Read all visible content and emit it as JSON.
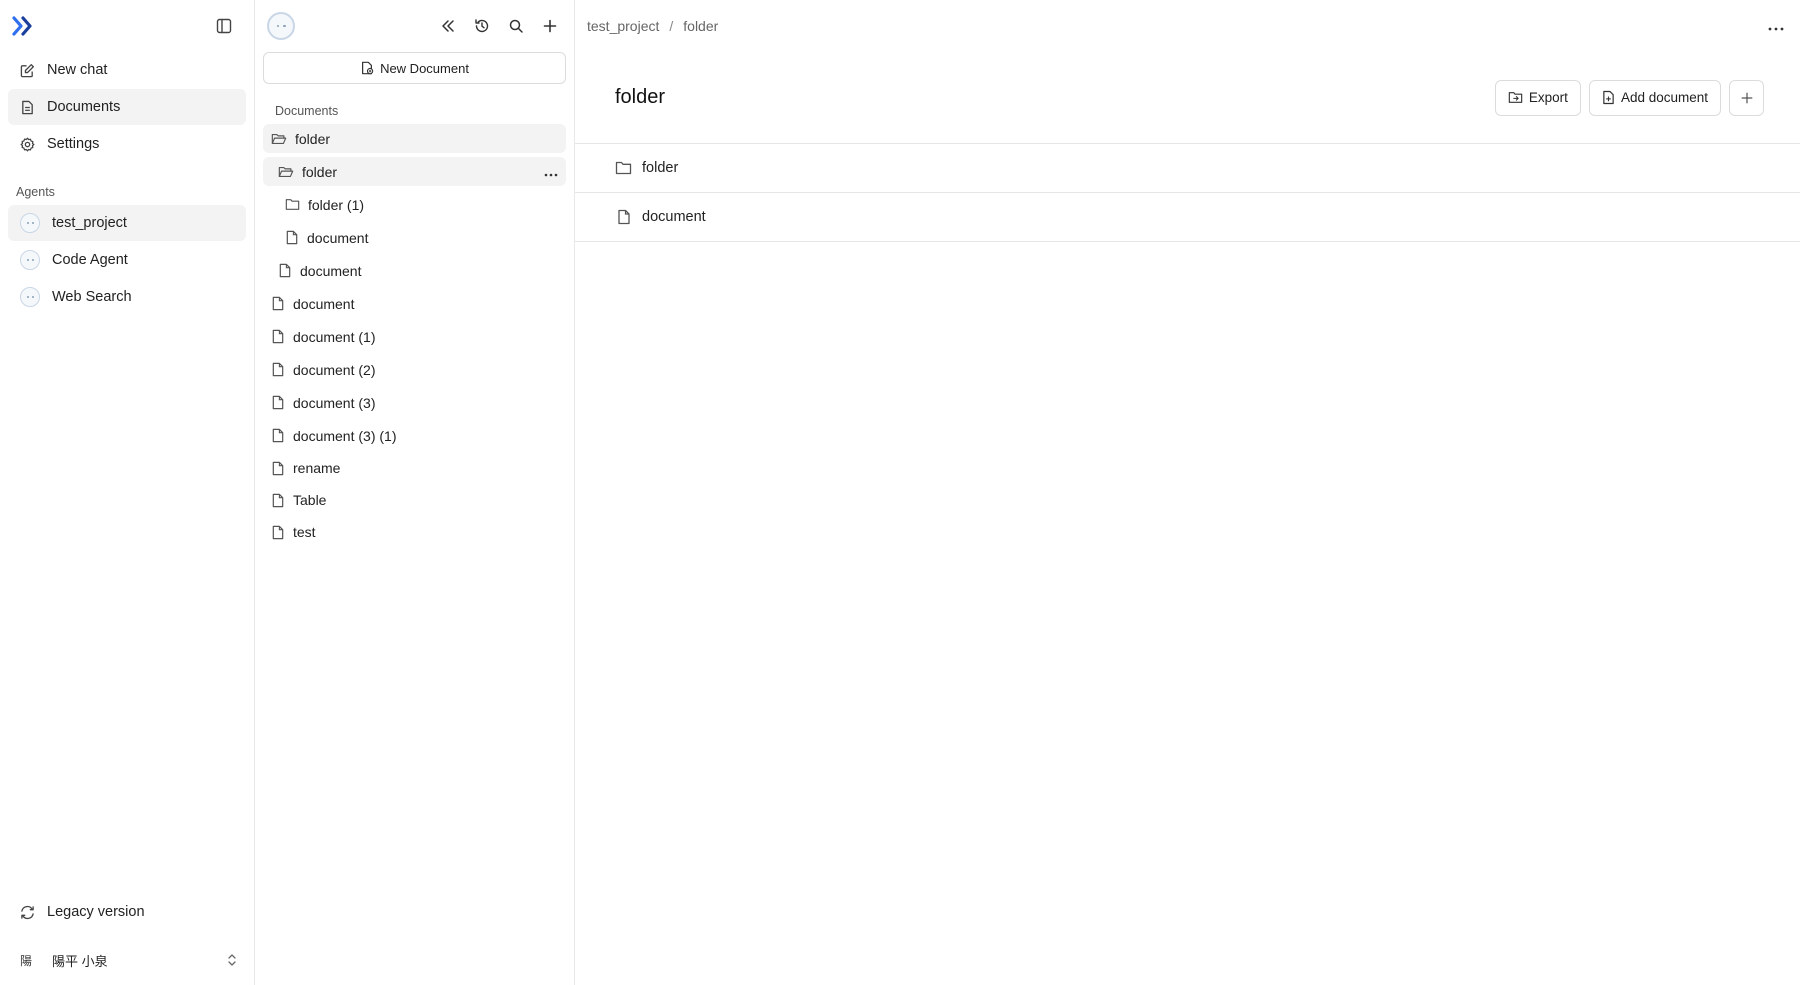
{
  "sidebar": {
    "nav": [
      {
        "label": "New chat",
        "icon": "edit-icon"
      },
      {
        "label": "Documents",
        "icon": "file-text-icon"
      },
      {
        "label": "Settings",
        "icon": "gear-icon"
      }
    ],
    "agents_label": "Agents",
    "agents": [
      {
        "label": "test_project"
      },
      {
        "label": "Code Agent"
      },
      {
        "label": "Web Search"
      }
    ],
    "legacy_label": "Legacy version",
    "user": {
      "initial": "陽",
      "name": "陽平 小泉"
    }
  },
  "tree": {
    "new_document_label": "New Document",
    "section_label": "Documents",
    "items": [
      {
        "label": "folder",
        "type": "folder-open",
        "depth": 0
      },
      {
        "label": "folder",
        "type": "folder-open",
        "depth": 1
      },
      {
        "label": "folder (1)",
        "type": "folder",
        "depth": 2
      },
      {
        "label": "document",
        "type": "file",
        "depth": 2
      },
      {
        "label": "document",
        "type": "file",
        "depth": 1
      },
      {
        "label": "document",
        "type": "file",
        "depth": 0
      },
      {
        "label": "document (1)",
        "type": "file",
        "depth": 0
      },
      {
        "label": "document (2)",
        "type": "file",
        "depth": 0
      },
      {
        "label": "document (3)",
        "type": "file",
        "depth": 0
      },
      {
        "label": "document (3) (1)",
        "type": "file",
        "depth": 0
      },
      {
        "label": "rename",
        "type": "file",
        "depth": 0
      },
      {
        "label": "Table",
        "type": "file",
        "depth": 0
      },
      {
        "label": "test",
        "type": "file",
        "depth": 0
      }
    ]
  },
  "main": {
    "breadcrumb": [
      "test_project",
      "folder"
    ],
    "breadcrumb_separator": "/",
    "title": "folder",
    "export_label": "Export",
    "add_document_label": "Add document",
    "items": [
      {
        "label": "folder",
        "type": "folder"
      },
      {
        "label": "document",
        "type": "file"
      }
    ]
  },
  "colors": {
    "accent": "#2f6fed",
    "border": "#e6e6e6",
    "active_bg": "#f3f3f3"
  }
}
